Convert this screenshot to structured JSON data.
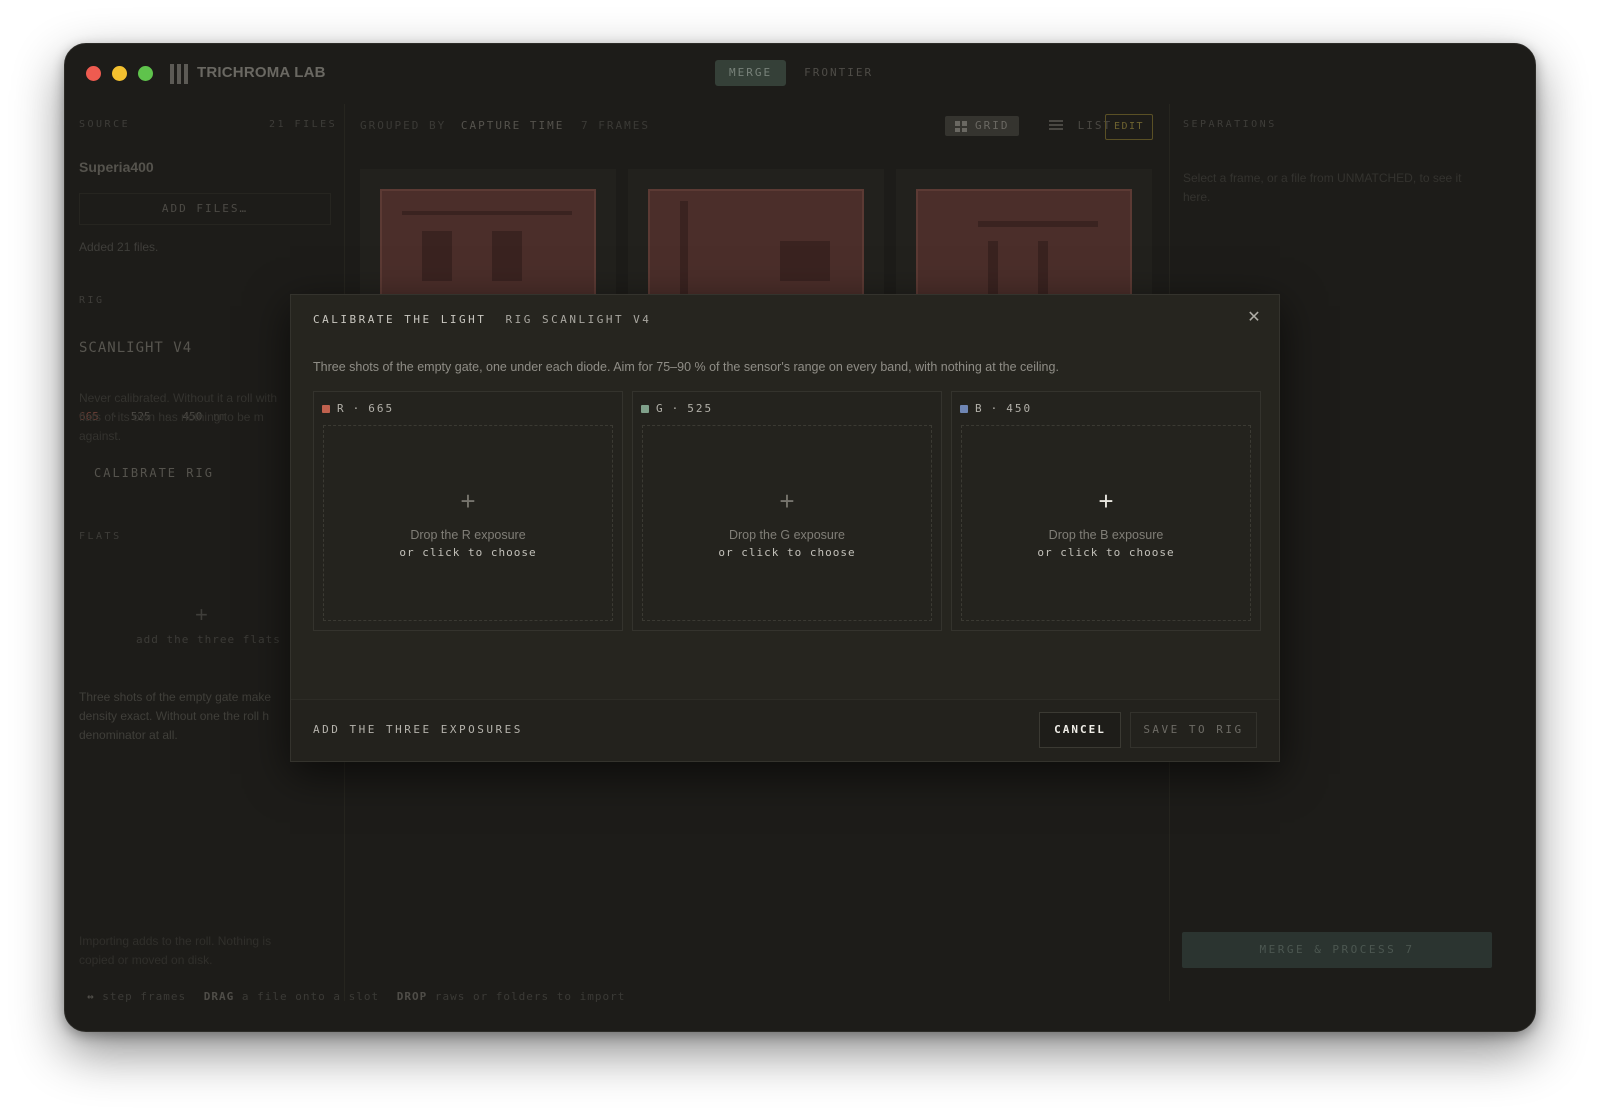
{
  "app": {
    "title": "TRICHROMA LAB",
    "tabs": [
      {
        "label": "MERGE",
        "active": true
      },
      {
        "label": "FRONTIER",
        "active": false
      }
    ]
  },
  "sidebar": {
    "source_label": "SOURCE",
    "file_count": "21 FILES",
    "roll_name": "Superia400",
    "add_files_label": "ADD FILES…",
    "added_note": "Added 21 files.",
    "rig_label": "RIG",
    "rig_name": "SCANLIGHT V4",
    "rig_bands": {
      "r": "665",
      "sep1": "·",
      "g": "525",
      "b": "450",
      "unit": "nm"
    },
    "rig_note_lines": [
      "Never calibrated. Without it a roll with",
      "flats of its own has nothing to be m",
      "against."
    ],
    "calibrate_label": "CALIBRATE RIG",
    "flats_label": "FLATS",
    "flats_add": "add the three flats",
    "flats_note_lines": [
      "Three shots of the empty gate make",
      "density exact. Without one the roll h",
      "denominator at all."
    ],
    "import_note_lines": [
      "Importing adds to the roll. Nothing is",
      "copied or moved on disk."
    ]
  },
  "main": {
    "grouped_by_label": "GROUPED BY",
    "grouped_by_value": "CAPTURE TIME",
    "frames_count": "7 FRAMES",
    "view_grid": "GRID",
    "view_list": "LIST",
    "edit_label": "EDIT"
  },
  "right": {
    "separations_label": "SEPARATIONS",
    "hint_lines": [
      "Select a frame, or a file from UNMATCHED, to see it",
      "here."
    ],
    "merge_button": "MERGE & PROCESS 7"
  },
  "status_bar": {
    "arrows": "↔",
    "step": "step frames",
    "drag_key": "DRAG",
    "drag_text": "a file onto a slot",
    "drop_key": "DROP",
    "drop_text": "raws or folders to import"
  },
  "modal": {
    "title": "CALIBRATE THE LIGHT",
    "subtitle": "RIG SCANLIGHT V4",
    "description": "Three shots of the empty gate, one under each diode. Aim for 75–90 % of the sensor's range on every band, with nothing at the ceiling.",
    "slots": [
      {
        "channel": "R",
        "wavelength": "665",
        "separator": "·",
        "color": "#c0614e",
        "drop_text": "Drop the R exposure",
        "choose_text": "or click to choose"
      },
      {
        "channel": "G",
        "wavelength": "525",
        "separator": "·",
        "color": "#7fa08a",
        "drop_text": "Drop the G exposure",
        "choose_text": "or click to choose"
      },
      {
        "channel": "B",
        "wavelength": "450",
        "separator": "·",
        "color": "#6f86b4",
        "drop_text": "Drop the B exposure",
        "choose_text": "or click to choose"
      }
    ],
    "footer_label": "ADD THE THREE EXPOSURES",
    "cancel_label": "CANCEL",
    "save_label": "SAVE TO RIG"
  }
}
